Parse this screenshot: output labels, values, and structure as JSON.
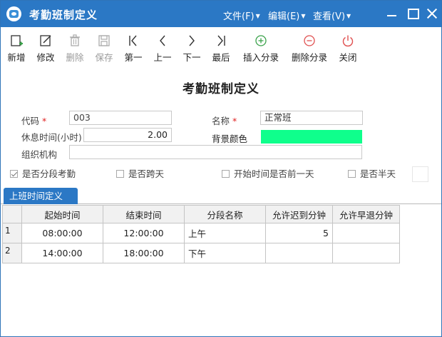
{
  "window": {
    "title": "考勤班制定义"
  },
  "menu": {
    "file": "文件(F)",
    "edit": "编辑(E)",
    "view": "查看(V)"
  },
  "toolbar": {
    "new": "新增",
    "edit": "修改",
    "delete": "删除",
    "save": "保存",
    "first": "第一",
    "prev": "上一",
    "next": "下一",
    "last": "最后",
    "insert_segment": "插入分录",
    "delete_segment": "删除分录",
    "close": "关闭"
  },
  "form": {
    "title": "考勤班制定义",
    "code_label": "代码",
    "code_value": "003",
    "name_label": "名称",
    "name_value": "正常班",
    "rest_label": "休息时间(小时)",
    "rest_value": "2.00",
    "bg_color_label": "背景颜色",
    "bg_color": "#0fff8c",
    "org_label": "组织机构",
    "org_value": "",
    "required_mark": "*"
  },
  "checkboxes": {
    "segment_attendance": {
      "label": "是否分段考勤",
      "checked": true
    },
    "cross_day": {
      "label": "是否跨天",
      "checked": false
    },
    "start_prev_day": {
      "label": "开始时间是否前一天",
      "checked": false
    },
    "half_day": {
      "label": "是否半天",
      "checked": false
    }
  },
  "tab": {
    "label": "上班时间定义"
  },
  "grid": {
    "headers": [
      "起始时间",
      "结束时间",
      "分段名称",
      "允许迟到分钟",
      "允许早退分钟"
    ],
    "rows": [
      {
        "num": "1",
        "start": "08:00:00",
        "end": "12:00:00",
        "name": "上午",
        "late": "5",
        "early": ""
      },
      {
        "num": "2",
        "start": "14:00:00",
        "end": "18:00:00",
        "name": "下午",
        "late": "",
        "early": ""
      }
    ]
  },
  "colors": {
    "titlebar": "#2b78c5",
    "tab": "#2b78c5",
    "accent_green": "#3aa24a",
    "accent_red": "#e05050"
  }
}
